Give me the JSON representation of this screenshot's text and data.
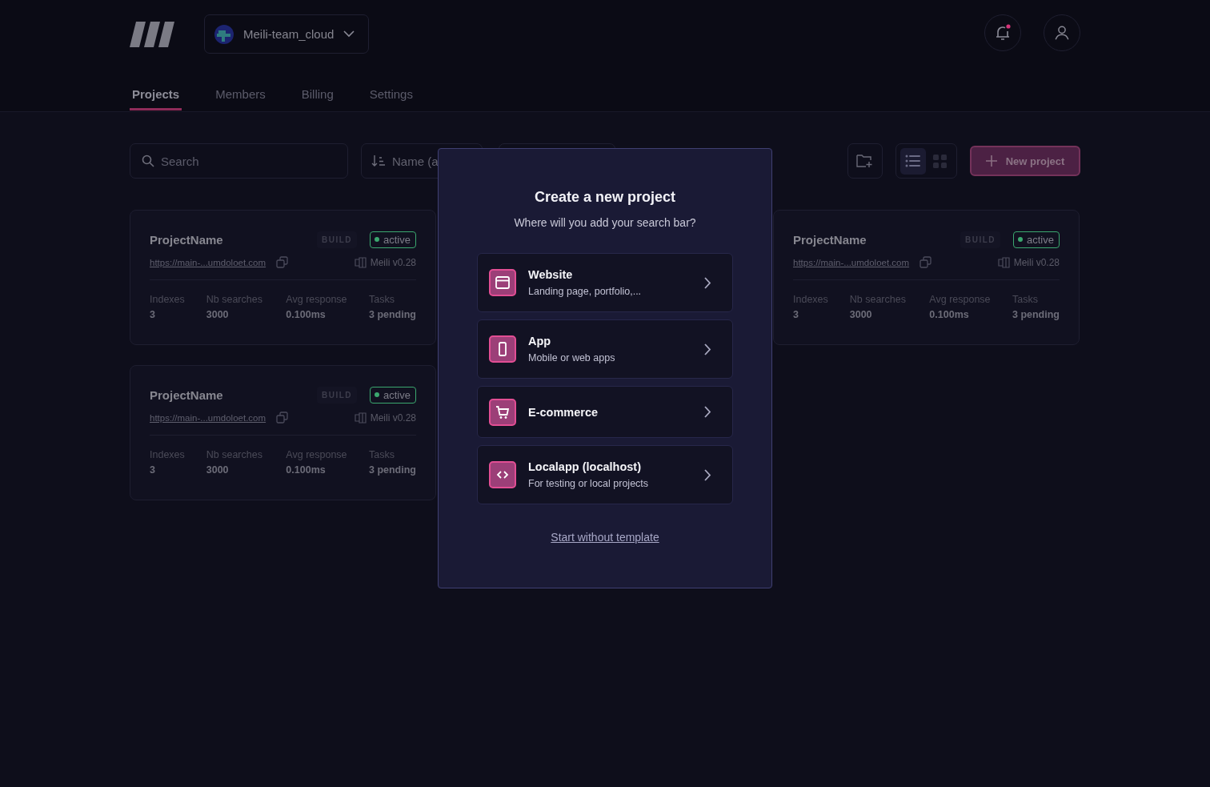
{
  "header": {
    "team": {
      "name": "Meili-team_cloud"
    },
    "notifications": {
      "unread": true
    }
  },
  "tabs": [
    {
      "label": "Projects",
      "selected": true
    },
    {
      "label": "Members",
      "selected": false
    },
    {
      "label": "Billing",
      "selected": false
    },
    {
      "label": "Settings",
      "selected": false
    }
  ],
  "toolbar": {
    "search": {
      "placeholder": "Search"
    },
    "sort": {
      "label": "Name (a"
    },
    "views": [
      {
        "kind": "list",
        "selected": true
      },
      {
        "kind": "grid",
        "selected": false
      }
    ],
    "new_project": "New project"
  },
  "projects_left": [
    {
      "name": "ProjectName",
      "tag": "BUILD",
      "status": "active",
      "color": "#3ba86f",
      "url": "https://main-...umdoloet.com",
      "version": "Meili v0.28",
      "stats": [
        {
          "label": "Indexes",
          "value": "3"
        },
        {
          "label": "Nb searches",
          "value": "3000"
        },
        {
          "label": "Avg response",
          "value": "0.100ms"
        },
        {
          "label": "Tasks",
          "value": "3 pending"
        }
      ]
    },
    {
      "name": "ProjectName",
      "tag": "BUILD",
      "status": "active",
      "color": "#3ba86f",
      "url": "https://main-...umdoloet.com",
      "version": "Meili v0.28",
      "stats": [
        {
          "label": "Indexes",
          "value": "3"
        },
        {
          "label": "Nb searches",
          "value": "3000"
        },
        {
          "label": "Avg response",
          "value": "0.100ms"
        },
        {
          "label": "Tasks",
          "value": "3 pending"
        }
      ]
    }
  ],
  "projects_right": [
    {
      "name": "ProjectName",
      "tag": "BUILD",
      "status": "active",
      "color": "#3ba86f",
      "url": "https://main-...umdoloet.com",
      "version": "Meili v0.28",
      "stats": [
        {
          "label": "Indexes",
          "value": "3"
        },
        {
          "label": "Nb searches",
          "value": "3000"
        },
        {
          "label": "Avg response",
          "value": "0.100ms"
        },
        {
          "label": "Tasks",
          "value": "3 pending"
        }
      ]
    }
  ],
  "modal": {
    "title": "Create a new project",
    "subtitle": "Where will you add your search bar?",
    "options": [
      {
        "kind": "website",
        "title": "Website",
        "description": "Landing page, portfolio,..."
      },
      {
        "kind": "app",
        "title": "App",
        "description": "Mobile or web apps"
      },
      {
        "kind": "ecommerce",
        "title": "E-commerce"
      },
      {
        "kind": "code",
        "title": "Localapp (localhost)",
        "description": "For testing or local projects"
      }
    ],
    "link": "Start without template"
  }
}
